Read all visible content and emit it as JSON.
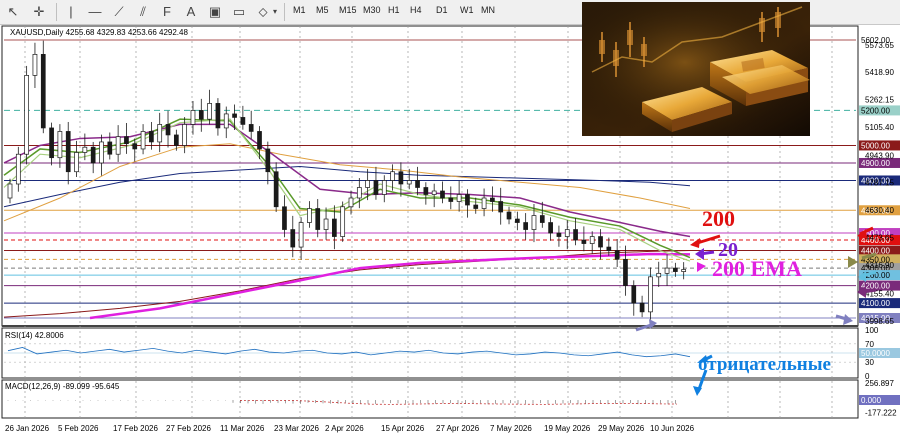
{
  "toolbar": {
    "timeframes": [
      "M1",
      "M5",
      "M15",
      "M30",
      "H1",
      "H4",
      "D1",
      "W1",
      "MN"
    ]
  },
  "symbol_info": "XAUUSD,Daily  4255.68 4329.83 4253.66 4292.48",
  "rsi_label": "RSI(14) 42.8006",
  "macd_label": "MACD(12,26,9) -89.099 -95.645",
  "annotations": {
    "ma200": "200",
    "ma20": "20",
    "ema200": "200 EMA",
    "negative": "отрицательные"
  },
  "colors": {
    "bg": "#ffffff",
    "ma200": "#8b1a1a",
    "ema200": "#e020e0",
    "ma20": "#5a9a2a",
    "ma_purple": "#8a2a8a",
    "ma_blue": "#1a2a7a",
    "ma_orange": "#e0a040",
    "ann_red": "#e01010",
    "ann_purple": "#7a20d0",
    "ann_magenta": "#e020e0",
    "ann_blue": "#1080e0",
    "up": "#1a1a1a",
    "down": "#1a1a1a"
  },
  "chart_data": {
    "type": "candlestick",
    "x_ticks": [
      "26 Jan 2026",
      "5 Feb 2026",
      "17 Feb 2026",
      "27 Feb 2026",
      "11 Mar 2026",
      "23 Mar 2026",
      "2 Apr 2026",
      "15 Apr 2026",
      "27 Apr 2026",
      "7 May 2026",
      "19 May 2026",
      "29 May 2026",
      "10 Jun 2026"
    ],
    "y_range": [
      4015,
      5602
    ],
    "price_ticks": [
      "5573.65",
      "5418.90",
      "5262.15",
      "5105.40",
      "4943.90",
      "4787.15",
      "4630.40",
      "4473.65",
      "4316.90",
      "4155.40",
      "3998.65"
    ],
    "levels": [
      {
        "label": "5602.00",
        "value": 5602,
        "color": "#8b1a1a",
        "bg": "#ffffff"
      },
      {
        "label": "5200.00",
        "value": 5200,
        "color": "#40b0a0",
        "bg": "#9ad0c8"
      },
      {
        "label": "5000.00",
        "value": 5000,
        "color": "#8b1a1a",
        "bg": "#8b1a1a"
      },
      {
        "label": "4900.00",
        "value": 4900,
        "color": "#7a2a7a",
        "bg": "#7a2a7a"
      },
      {
        "label": "4800.00",
        "value": 4800,
        "color": "#1a2a7a",
        "bg": "#1a2a7a"
      },
      {
        "label": "4630.00",
        "value": 4630,
        "color": "#e0a040",
        "bg": "#e0a040"
      },
      {
        "label": "4500.00",
        "value": 4500,
        "color": "#c040c0",
        "bg": "#c040c0"
      },
      {
        "label": "4460.00",
        "value": 4460,
        "color": "#e01010",
        "bg": "#e01010"
      },
      {
        "label": "4400.00",
        "value": 4400,
        "color": "#8b1a1a",
        "bg": "#8b1a1a"
      },
      {
        "label": "4350.00",
        "value": 4350,
        "color": "#e0a040",
        "bg": "#d0b060"
      },
      {
        "label": "4300.00",
        "value": 4300,
        "color": "#7a7a7a",
        "bg": "#a0a0a0"
      },
      {
        "label": "4260.00",
        "value": 4260,
        "color": "#60c0e0",
        "bg": "#70c0e0"
      },
      {
        "label": "4200.00",
        "value": 4200,
        "color": "#7a2a7a",
        "bg": "#7a2a7a"
      },
      {
        "label": "4100.00",
        "value": 4100,
        "color": "#1a2a7a",
        "bg": "#1a2a7a"
      },
      {
        "label": "4015.00",
        "value": 4015,
        "color": "#8080c0",
        "bg": "#8080c0"
      }
    ],
    "rsi_ticks": [
      "100",
      "70",
      "30",
      "0"
    ],
    "rsi_level_label": "50.0000",
    "macd_ticks": [
      "256.897",
      "0.000",
      "-177.222"
    ]
  }
}
